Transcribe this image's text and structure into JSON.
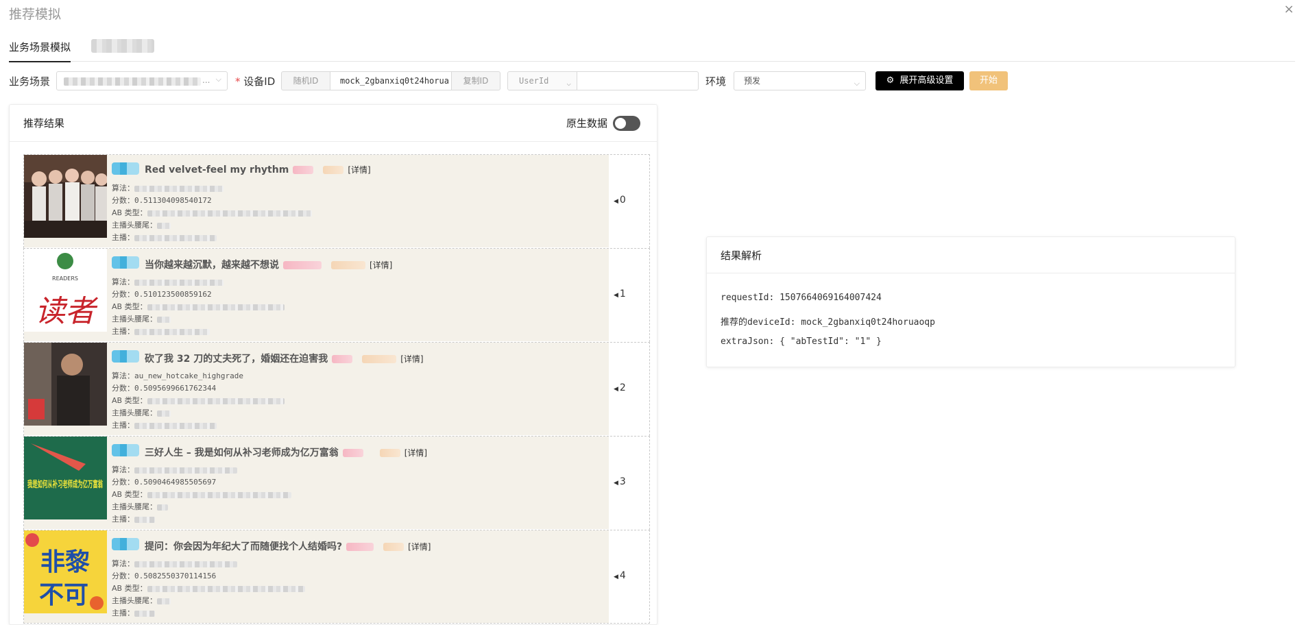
{
  "modal": {
    "title": "推荐模拟",
    "close_icon": "×"
  },
  "tabs": {
    "active_label": "业务场景模拟",
    "second_label": ""
  },
  "filters": {
    "scene_label": "业务场景",
    "scene_value_suffix": "...",
    "device_label": "设备ID",
    "device_required_mark": "*",
    "random_id_label": "随机ID",
    "device_id_value": "mock_2gbanxiq0t24horua",
    "copy_id_label": "复制ID",
    "userid_select": "UserId",
    "userid_value": "",
    "env_label": "环境",
    "env_value": "预发",
    "advanced_button": "展开高级设置",
    "advanced_icon": "⚙",
    "start_button": "开始"
  },
  "results": {
    "title": "推荐结果",
    "raw_data_label": "原生数据",
    "raw_data_on": false,
    "items": [
      {
        "title": "Red velvet-feel my rhythm",
        "detail": "[详情]",
        "algo_label": "算法：",
        "algo_value": "",
        "score_label": "分数：",
        "score_value": "0.511304098540172",
        "ab_label": "AB 类型：",
        "anchor_head_label": "主播头腰尾：",
        "anchor_label": "主播：",
        "index": "0",
        "thumb": "group-photo"
      },
      {
        "title": "当你越来越沉默，越来越不想说",
        "detail": "[详情]",
        "algo_label": "算法：",
        "algo_value": "",
        "score_label": "分数：",
        "score_value": "0.510123500859162",
        "ab_label": "AB 类型：",
        "anchor_head_label": "主播头腰尾：",
        "anchor_label": "主播：",
        "index": "1",
        "thumb": "readers-logo",
        "thumb_text_small": "READERS",
        "thumb_text_big": "读者"
      },
      {
        "title": "砍了我 32 刀的丈夫死了，婚姻还在迫害我",
        "detail": "[详情]",
        "algo_label": "算法：",
        "algo_value": "au_new_hotcake_highgrade",
        "score_label": "分数：",
        "score_value": "0.5095699661762344",
        "ab_label": "AB 类型：",
        "anchor_head_label": "主播头腰尾：",
        "anchor_label": "主播：",
        "index": "2",
        "thumb": "man-portrait"
      },
      {
        "title": "三好人生 – 我是如何从补习老师成为亿万富翁",
        "detail": "[详情]",
        "algo_label": "算法：",
        "algo_value": "",
        "score_label": "分数：",
        "score_value": "0.5090464985505697",
        "ab_label": "AB 类型：",
        "anchor_head_label": "主播头腰尾：",
        "anchor_label": "主播：",
        "index": "3",
        "thumb": "green-poster",
        "thumb_text": "我是如何从补习老师成为亿万富翁"
      },
      {
        "title": "提问：你会因为年纪大了而随便找个人结婚吗?",
        "detail": "[详情]",
        "algo_label": "算法：",
        "algo_value": "",
        "score_label": "分数：",
        "score_value": "0.5082550370114156",
        "ab_label": "AB 类型：",
        "anchor_head_label": "主播头腰尾：",
        "anchor_label": "主播：",
        "index": "4",
        "thumb": "yellow-poster",
        "thumb_text_top": "非黎",
        "thumb_text_bottom": "不可"
      }
    ]
  },
  "analysis": {
    "title": "结果解析",
    "request_id_label": "requestId: ",
    "request_id_value": "1507664069164007424",
    "device_id_label": "推荐的deviceId: ",
    "device_id_value": "mock_2gbanxiq0t24horuaoqp",
    "extra_json_label": "extraJson: ",
    "extra_json_value": "{ \"abTestId\": \"1\" }"
  },
  "colors": {
    "primary_button": "#000000",
    "start_button": "#f1c27a",
    "item_bg": "#f4f1e9"
  }
}
